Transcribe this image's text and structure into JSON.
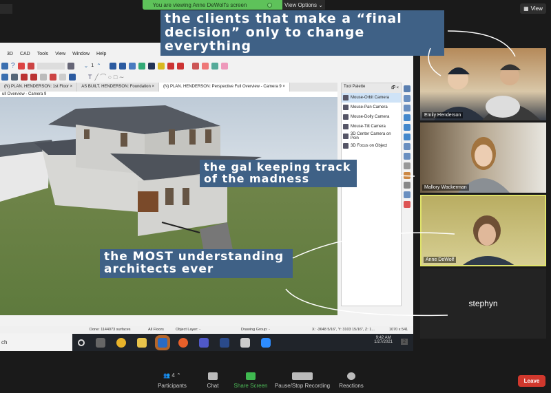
{
  "zoom": {
    "banner": "You are viewing Anne DeWolf's screen",
    "view_options": "View Options ⌄",
    "view": "View",
    "leave": "Leave",
    "toolbar": [
      {
        "label": "Participants",
        "badge": "4"
      },
      {
        "label": "Chat"
      },
      {
        "label": "Share Screen"
      },
      {
        "label": "Pause/Stop Recording"
      },
      {
        "label": "Reactions"
      }
    ]
  },
  "captions": {
    "clients": "the clients that make a “final decision” only to change everything",
    "gal": "the gal keeping track of the madness",
    "architects": "the MOST understanding architects ever"
  },
  "participants": [
    "Emily Henderson",
    "Mallory Wackerman",
    "Anne DeWolf",
    "stephyn"
  ],
  "app": {
    "menu": [
      "3D",
      "CAD",
      "Tools",
      "View",
      "Window",
      "Help"
    ],
    "tabs": [
      "(N) PLAN. HENDERSON: 1st Floor ×",
      "AS BUILT. HENDERSON: Foundation ×",
      "(N) PLAN. HENDERSON: Perspective Full Overview - Camera 9 ×"
    ],
    "view_title": "ull Overview - Camera 9",
    "palette": {
      "title": "Tool Palette",
      "items": [
        "Mouse-Orbit Camera",
        "Mouse-Pan Camera",
        "Mouse-Dolly Camera",
        "Mouse-Tilt Camera",
        "3D Center Camera on Poin",
        "3D Focus on Object"
      ]
    },
    "status": {
      "done": "Done:  1144073 surfaces",
      "floors": "All Floors",
      "layer": "Object Layer: -",
      "group": "Drawing Group: -",
      "coords": "X: -3648 5/16\", Y: 3103 15/16\", Z: 1...",
      "size": "1070 x 541"
    },
    "taskbar": {
      "search": "ch",
      "time": "9:42 AM",
      "date": "1/27/2021",
      "notif": "2"
    },
    "toolbar_number": "1"
  }
}
